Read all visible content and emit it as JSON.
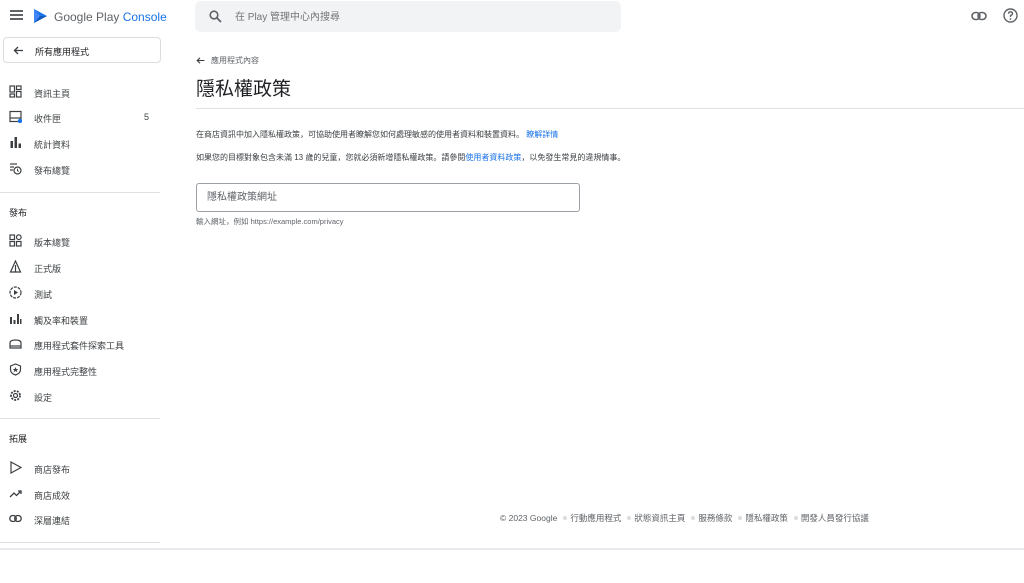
{
  "header": {
    "brand_prefix": "Google Play ",
    "brand_suffix": "Console",
    "search_placeholder": "在 Play 管理中心內搜尋",
    "icons": [
      "menu-icon",
      "play-console-logo-icon",
      "search-icon",
      "link-icon",
      "help-icon"
    ]
  },
  "sidebar": {
    "back_label": "所有應用程式",
    "items_top": [
      {
        "label": "資訊主頁",
        "icon": "dashboard-icon"
      },
      {
        "label": "收件匣",
        "icon": "inbox-icon",
        "count": "5"
      },
      {
        "label": "統計資料",
        "icon": "statistics-icon"
      },
      {
        "label": "發布總覽",
        "icon": "publishing-overview-icon"
      }
    ],
    "section_release": "發布",
    "items_release": [
      {
        "label": "版本總覽",
        "icon": "releases-overview-icon"
      },
      {
        "label": "正式版",
        "icon": "production-icon"
      },
      {
        "label": "測試",
        "icon": "testing-icon"
      },
      {
        "label": "觸及率和裝置",
        "icon": "reach-devices-icon"
      },
      {
        "label": "應用程式套件探索工具",
        "icon": "bundle-explorer-icon"
      },
      {
        "label": "應用程式完整性",
        "icon": "app-integrity-icon"
      },
      {
        "label": "設定",
        "icon": "settings-icon"
      }
    ],
    "section_grow": "拓展",
    "items_grow": [
      {
        "label": "商店發布",
        "icon": "store-presence-icon"
      },
      {
        "label": "商店成效",
        "icon": "store-performance-icon"
      },
      {
        "label": "深層連結",
        "icon": "deep-links-icon"
      }
    ]
  },
  "main": {
    "breadcrumb": "應用程式內容",
    "title": "隱私權政策",
    "desc1_text": "在商店資訊中加入隱私權政策，可協助使用者瞭解您如何處理敏感的使用者資料和裝置資料。",
    "desc1_link": "瞭解詳情",
    "desc2_before": "如果您的目標對象包含未滿 13 歲的兒童，您就必須新增隱私權政策。請參閱",
    "desc2_link": "使用者資料政策",
    "desc2_after": "，以免發生常見的違規情事。",
    "url_placeholder": "隱私權政策網址",
    "url_value": "",
    "helper": "輸入網址，例如 https://example.com/privacy"
  },
  "footer": {
    "copyright": "© 2023 Google",
    "links": [
      "行動應用程式",
      "狀態資訊主頁",
      "服務條款",
      "隱私權政策",
      "開發人員發行協議"
    ]
  },
  "colors": {
    "accent": "#1a73e8",
    "text": "#202124",
    "muted": "#5f6368"
  }
}
